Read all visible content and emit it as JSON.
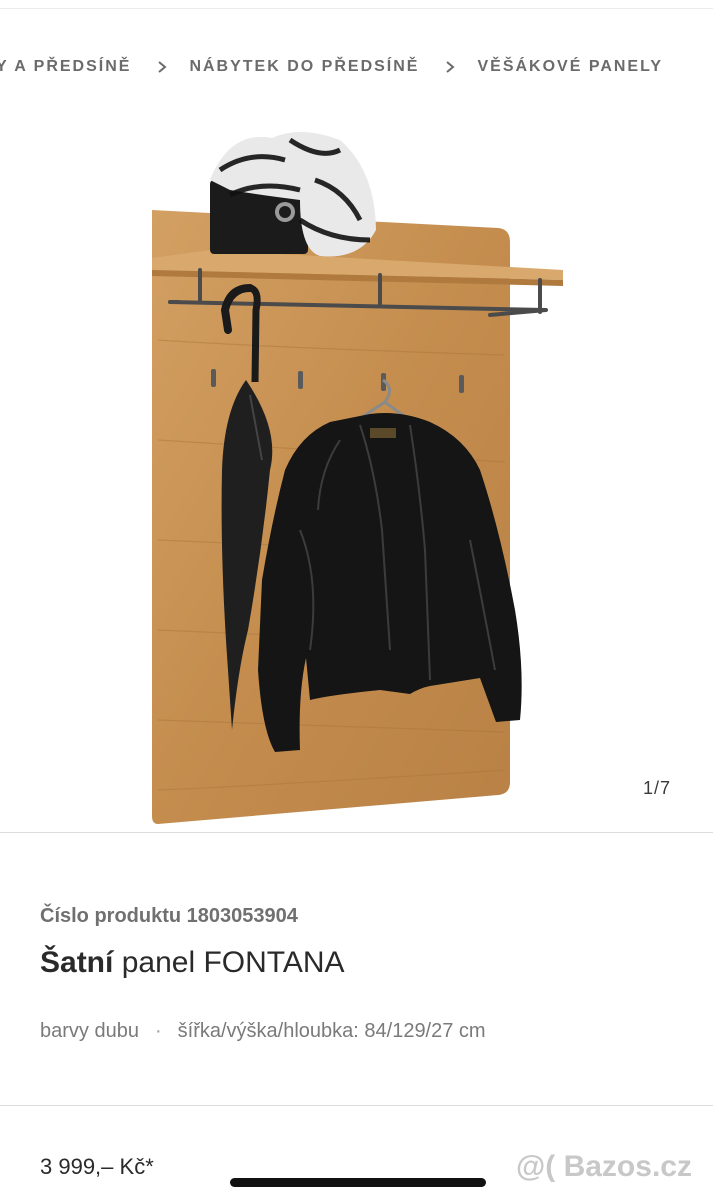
{
  "breadcrumb": {
    "items": [
      "Y A PŘEDSÍNĚ",
      "NÁBYTEK DO PŘEDSÍNĚ",
      "VĚŠÁKOVÉ PANELY"
    ]
  },
  "gallery": {
    "counter": "1/7",
    "image_alt": "Šatní panel FONTANA"
  },
  "product": {
    "number_label": "Číslo produktu",
    "number_value": "1803053904",
    "title_bold": "Šatní",
    "title_rest": "panel FONTANA",
    "color": "barvy dubu",
    "separator": "·",
    "dimensions": "šířka/výška/hloubka: 84/129/27 cm",
    "price": "3 999,– Kč*"
  },
  "watermark": "@( Bazos.cz",
  "colors": {
    "wood": "#c8934f",
    "text": "#2d2d2d",
    "muted": "#7a7a7a"
  }
}
